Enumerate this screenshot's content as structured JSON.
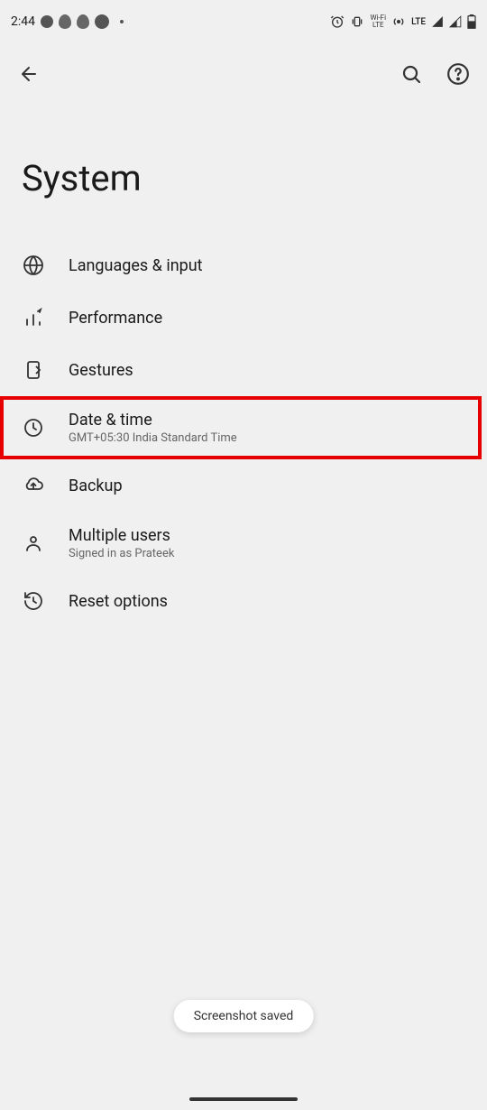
{
  "status_bar": {
    "time": "2:44",
    "lte": "LTE",
    "wifi_label": "Wi‑Fi\nLTE"
  },
  "app_bar": {},
  "page": {
    "title": "System"
  },
  "menu": {
    "items": [
      {
        "label": "Languages & input",
        "sub": ""
      },
      {
        "label": "Performance",
        "sub": ""
      },
      {
        "label": "Gestures",
        "sub": ""
      },
      {
        "label": "Date & time",
        "sub": "GMT+05:30 India Standard Time"
      },
      {
        "label": "Backup",
        "sub": ""
      },
      {
        "label": "Multiple users",
        "sub": "Signed in as Prateek"
      },
      {
        "label": "Reset options",
        "sub": ""
      }
    ]
  },
  "toast": {
    "label": "Screenshot saved"
  }
}
